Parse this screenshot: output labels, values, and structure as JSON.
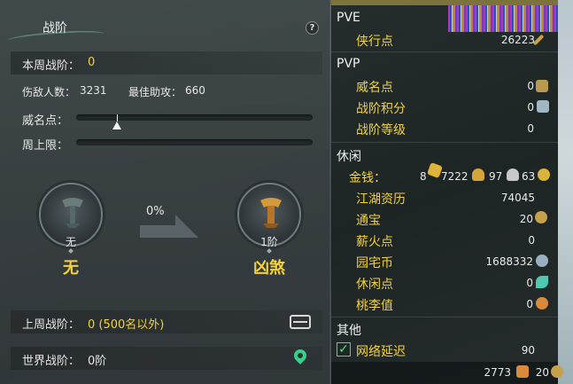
{
  "left_panel": {
    "title": "战阶",
    "help_glyph": "?",
    "weekly_rank_label": "本周战阶：",
    "weekly_rank_value": "0",
    "kills_label": "伤敌人数：",
    "kills_value": "3231",
    "assist_label": "最佳助攻：",
    "assist_value": "660",
    "prestige_label": "威名点：",
    "weekly_cap_label": "周上限：",
    "progress_percent": "0%",
    "current_medal_caption": "无",
    "current_medal_name": "无",
    "next_medal_caption": "1阶",
    "next_medal_name": "凶煞",
    "last_week_label": "上周战阶：",
    "last_week_value": "0 (500名以外)",
    "world_rank_label": "世界战阶：",
    "world_rank_value": "0阶"
  },
  "right_panel": {
    "pve_title": "PVE",
    "pve_items": [
      {
        "label": "侠行点",
        "value": "26223"
      }
    ],
    "pvp_title": "PVP",
    "pvp_items": [
      {
        "label": "威名点",
        "value": "0"
      },
      {
        "label": "战阶积分",
        "value": "0"
      },
      {
        "label": "战阶等级",
        "value": "0"
      }
    ],
    "leisure_title": "休闲",
    "money_label": "金钱：",
    "money_gold": "8",
    "money_silver": "7222",
    "money_copper1": "97",
    "money_copper2": "63",
    "leisure_items": [
      {
        "label": "江湖资历",
        "value": "74045"
      },
      {
        "label": "通宝",
        "value": "20"
      },
      {
        "label": "薪火点",
        "value": "0"
      },
      {
        "label": "园宅币",
        "value": "1688332"
      },
      {
        "label": "休闲点",
        "value": "0"
      },
      {
        "label": "桃李值",
        "value": "0"
      }
    ],
    "other_title": "其他",
    "network_label": "网络延迟",
    "network_value": "90",
    "footer_a": "2773",
    "footer_b": "20"
  },
  "colors": {
    "accent_yellow": "#f3d23a",
    "panel_dark": "#363c3f",
    "check_green": "#5fe08c"
  }
}
